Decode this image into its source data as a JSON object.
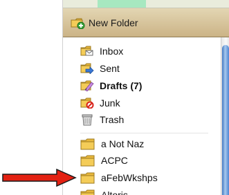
{
  "toolbar": {
    "new_folder_label": "New Folder"
  },
  "folders": {
    "inbox": {
      "label": "Inbox",
      "icon": "inbox-folder-icon"
    },
    "sent": {
      "label": "Sent",
      "icon": "sent-folder-icon"
    },
    "drafts": {
      "label": "Drafts (7)",
      "icon": "drafts-folder-icon",
      "bold": true
    },
    "junk": {
      "label": "Junk",
      "icon": "junk-folder-icon"
    },
    "trash": {
      "label": "Trash",
      "icon": "trash-can-icon"
    },
    "user": [
      {
        "label": "a Not Naz"
      },
      {
        "label": "ACPC"
      },
      {
        "label": "aFebWkshps"
      },
      {
        "label": "Altoris"
      }
    ]
  },
  "colors": {
    "toolbar": "#cbb386",
    "folder": "#f2c64a",
    "scroll_thumb": "#3f76c1",
    "arrow": "#e32112"
  }
}
